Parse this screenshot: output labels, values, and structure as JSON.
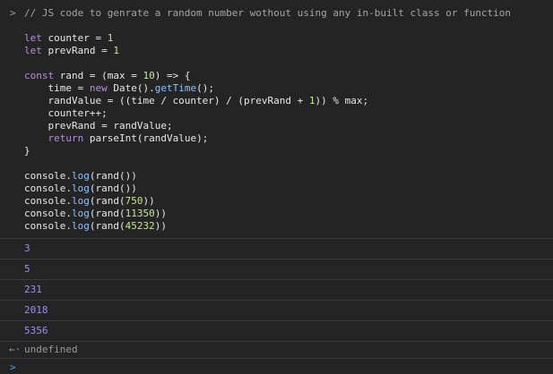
{
  "input": {
    "prompt_glyph": ">",
    "code_lines": [
      [
        {
          "t": "comment",
          "v": "// JS code to genrate a random number wothout using any in-built class or function"
        }
      ],
      [],
      [
        {
          "t": "kw",
          "v": "let"
        },
        {
          "t": "plain",
          "v": " counter = "
        },
        {
          "t": "num",
          "v": "1"
        }
      ],
      [
        {
          "t": "kw",
          "v": "let"
        },
        {
          "t": "plain",
          "v": " prevRand = "
        },
        {
          "t": "num",
          "v": "1"
        }
      ],
      [],
      [
        {
          "t": "kw",
          "v": "const"
        },
        {
          "t": "plain",
          "v": " rand = (max = "
        },
        {
          "t": "num",
          "v": "10"
        },
        {
          "t": "plain",
          "v": ") => {"
        }
      ],
      [
        {
          "t": "plain",
          "v": "    time = "
        },
        {
          "t": "kw",
          "v": "new"
        },
        {
          "t": "plain",
          "v": " Date()."
        },
        {
          "t": "fn",
          "v": "getTime"
        },
        {
          "t": "plain",
          "v": "();"
        }
      ],
      [
        {
          "t": "plain",
          "v": "    randValue = ((time / counter) / (prevRand + "
        },
        {
          "t": "num",
          "v": "1"
        },
        {
          "t": "plain",
          "v": ")) % max;"
        }
      ],
      [
        {
          "t": "plain",
          "v": "    counter++;"
        }
      ],
      [
        {
          "t": "plain",
          "v": "    prevRand = randValue;"
        }
      ],
      [
        {
          "t": "plain",
          "v": "    "
        },
        {
          "t": "kw",
          "v": "return"
        },
        {
          "t": "plain",
          "v": " parseInt(randValue);"
        }
      ],
      [
        {
          "t": "plain",
          "v": "}"
        }
      ],
      [],
      [
        {
          "t": "plain",
          "v": "console."
        },
        {
          "t": "fn",
          "v": "log"
        },
        {
          "t": "plain",
          "v": "(rand())"
        }
      ],
      [
        {
          "t": "plain",
          "v": "console."
        },
        {
          "t": "fn",
          "v": "log"
        },
        {
          "t": "plain",
          "v": "(rand())"
        }
      ],
      [
        {
          "t": "plain",
          "v": "console."
        },
        {
          "t": "fn",
          "v": "log"
        },
        {
          "t": "plain",
          "v": "(rand("
        },
        {
          "t": "num",
          "v": "750"
        },
        {
          "t": "plain",
          "v": "))"
        }
      ],
      [
        {
          "t": "plain",
          "v": "console."
        },
        {
          "t": "fn",
          "v": "log"
        },
        {
          "t": "plain",
          "v": "(rand("
        },
        {
          "t": "num",
          "v": "11350"
        },
        {
          "t": "plain",
          "v": "))"
        }
      ],
      [
        {
          "t": "plain",
          "v": "console."
        },
        {
          "t": "fn",
          "v": "log"
        },
        {
          "t": "plain",
          "v": "(rand("
        },
        {
          "t": "num",
          "v": "45232"
        },
        {
          "t": "plain",
          "v": "))"
        }
      ]
    ]
  },
  "outputs": [
    "3",
    "5",
    "231",
    "2018",
    "5356"
  ],
  "return_value": {
    "icon_glyph": "←·",
    "text": "undefined"
  },
  "prompt": {
    "icon_glyph": ">"
  },
  "colors": {
    "background": "#242424",
    "comment": "#a6a6a6",
    "keyword": "#b78fd8",
    "number": "#c3e88d",
    "function": "#8ac2ff",
    "output_number": "#9f8ef0",
    "prompt_accent": "#4aa1ff"
  }
}
